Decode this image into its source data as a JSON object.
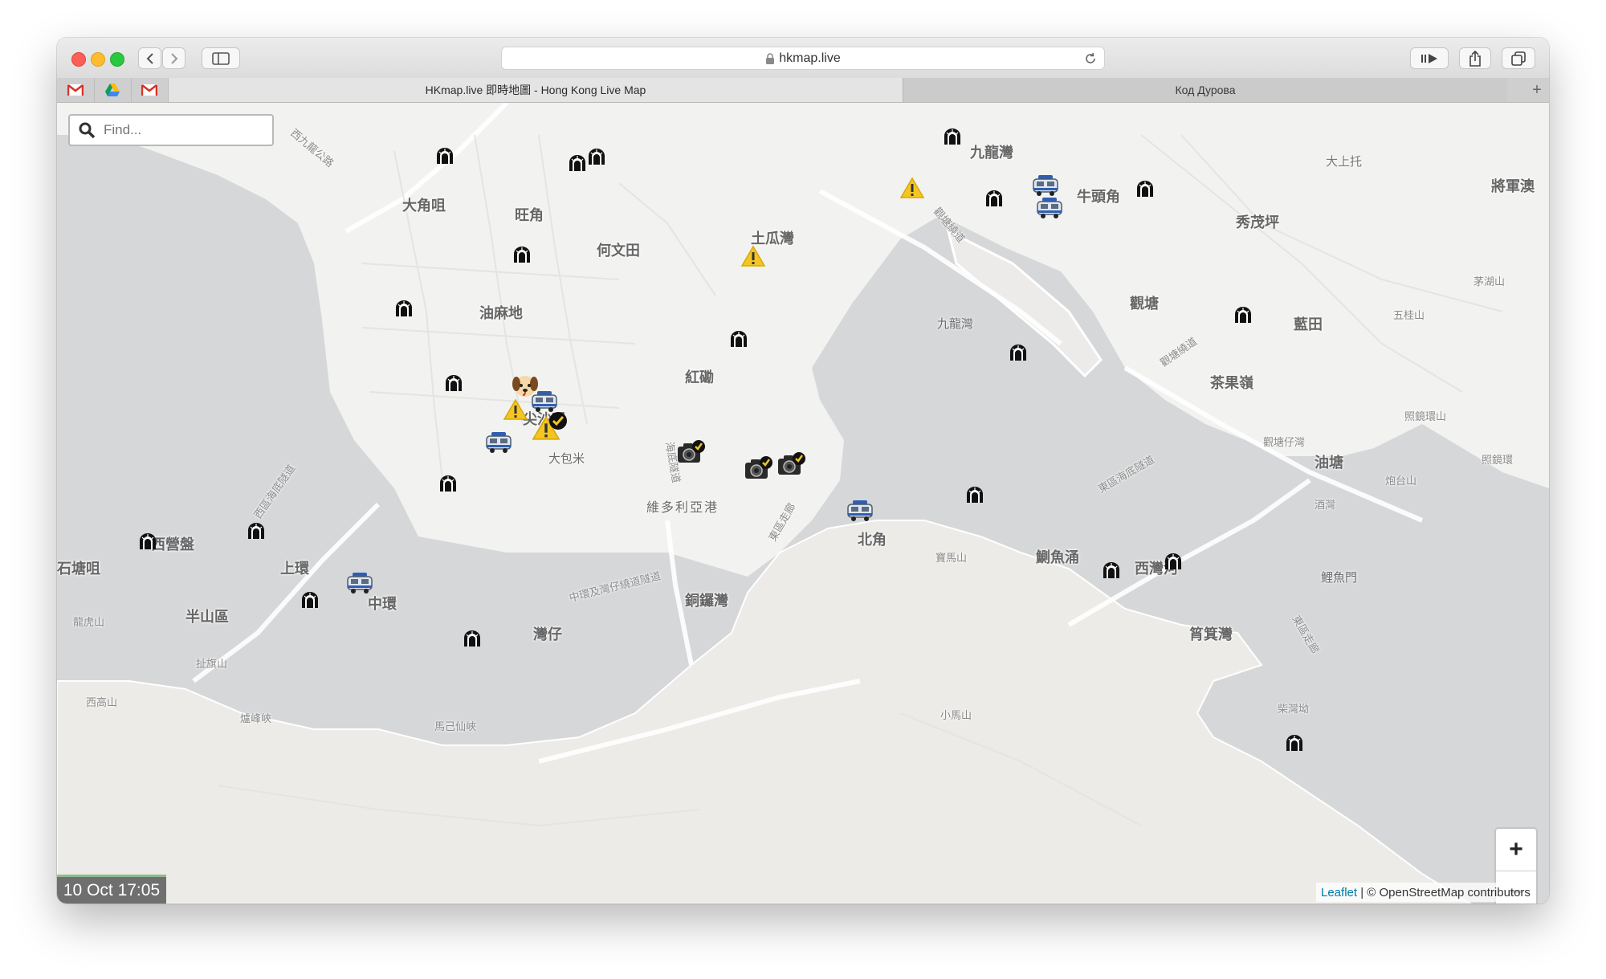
{
  "browser": {
    "url": "hkmap.live",
    "tabs": [
      {
        "title": "HKmap.live 即時地圖 - Hong Kong Live Map",
        "active": true
      },
      {
        "title": "Код Дурова",
        "active": false
      }
    ],
    "favorites": [
      "gmail-icon",
      "google-drive-icon",
      "gmail-icon"
    ],
    "new_tab_symbol": "+"
  },
  "search": {
    "placeholder": "Find..."
  },
  "zoom": {
    "in_label": "+",
    "out_label": "−"
  },
  "timestamp": "10 Oct 17:05",
  "attribution": {
    "leaflet": "Leaflet",
    "separator": " | ",
    "osm": "© OpenStreetMap contributors"
  },
  "map_labels": {
    "taikoktsui": "大角咀",
    "mongkok": "旺角",
    "howmanting": "何文田",
    "tokwawan": "土瓜灣",
    "yaumatei": "油麻地",
    "hunghom": "紅磡",
    "tsimshatsui": "尖沙咀",
    "taipaomei": "大包米",
    "victoria_harbour": "維多利亞港",
    "kowloon_bay_top": "九龍灣",
    "kowloon_bay_water": "九龍灣",
    "ngautaukok": "牛頭角",
    "kwuntong": "觀塘",
    "lamtin": "藍田",
    "sauMauPing": "秀茂坪",
    "taiShangTok": "大上托",
    "tseungkwano": "將軍澳",
    "chaKwoLing": "茶果嶺",
    "yautong": "油塘",
    "northpoint": "北角",
    "quarryBay": "鰂魚涌",
    "saiwanho": "西灣河",
    "shaukeiwan": "筲箕灣",
    "causewaybay": "銅鑼灣",
    "wanchai": "灣仔",
    "central": "中環",
    "sheungwan": "上環",
    "saiyingpun": "西營盤",
    "shektongtsui": "石塘咀",
    "midlevels": "半山區",
    "lyemun": "鯉魚門",
    "westKowloonHwy": "西九龍公路",
    "westHarbourTunnel": "西區海底隧道",
    "crossHarbourTunnel": "海底隧道",
    "eastHarbourTunnel": "東區海底隧道",
    "eastCorridor": "東區走廊",
    "eastCorridor2": "東區走廊",
    "centralWanchaiBypass": "中環及灣仔繞道隧道",
    "kwunTongBypass": "觀塘繞道",
    "kwunTongBypass2": "觀塘繞道",
    "braemarHill": "寶馬山",
    "lungFuShan": "龍虎山",
    "kotewallHill": "扯旗山",
    "highWest": "西高山",
    "thePeak": "爐峰峽",
    "mountCameron": "馬己仙峽",
    "mountParker": "小馬山",
    "chaiWanKok": "柴灣坳",
    "maoHuShan": "茅湖山",
    "ngKwaiShan": "五桂山",
    "chiuKengShan": "照鏡環山",
    "chiuKeng": "照鏡環",
    "kwunTongTsuen": "觀塘仔灣",
    "pauTaiShan": "炮台山",
    "samKaTsuen": "酒灣"
  },
  "markers": [
    {
      "type": "tunnel-icon"
    },
    {
      "type": "police-van-icon"
    },
    {
      "type": "warning-icon"
    },
    {
      "type": "camera-icon"
    },
    {
      "type": "dog-icon"
    },
    {
      "type": "check-badge-icon"
    }
  ],
  "colors": {
    "warning": "#f3c623",
    "map_bg": "#f2f2f0",
    "water": "#d6d7d9",
    "link": "#0078a8"
  }
}
